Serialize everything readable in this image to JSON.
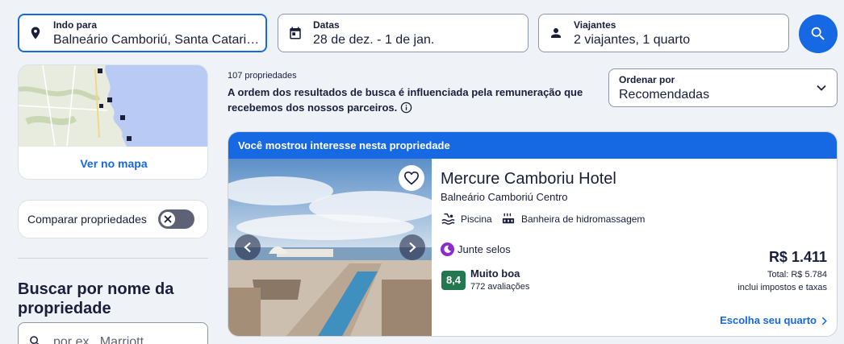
{
  "search": {
    "destination": {
      "label": "Indo para",
      "value": "Balneário Camboriú, Santa Catarina, Brasil",
      "icon": "location-pin-icon"
    },
    "dates": {
      "label": "Datas",
      "value": "28 de dez. - 1 de jan.",
      "icon": "calendar-icon"
    },
    "travelers": {
      "label": "Viajantes",
      "value": "2 viajantes, 1 quarto",
      "icon": "person-icon"
    },
    "search_icon": "magnifier-icon"
  },
  "sidebar": {
    "map_link": "Ver no mapa",
    "compare_label": "Comparar propriedades",
    "compare_enabled": false,
    "name_search_title": "Buscar por nome da propriedade",
    "name_search_placeholder": "por ex., Marriott"
  },
  "results": {
    "count": "107 propriedades",
    "notice": "A ordem dos resultados de busca é influenciada pela remuneração que recebemos dos nossos parceiros.",
    "sort_label": "Ordenar por",
    "sort_value": "Recomendadas"
  },
  "listing": {
    "banner": "Você mostrou interesse nesta propriedade",
    "name": "Mercure Camboriu Hotel",
    "area": "Balneário Camboriú Centro",
    "amenities": [
      {
        "label": "Piscina",
        "icon": "pool-icon"
      },
      {
        "label": "Banheira de hidromassagem",
        "icon": "hot-tub-icon"
      }
    ],
    "stamps": "Junte selos",
    "rating": "8,4",
    "rating_word": "Muito boa",
    "reviews": "772 avaliações",
    "price": "R$ 1.411",
    "total": "Total: R$ 5.784",
    "taxes": "inclui impostos e taxas",
    "cta": "Escolha seu quarto"
  },
  "colors": {
    "accent": "#1668e3",
    "rating_green": "#227950",
    "stamps_purple": "#8c2bc9",
    "text": "#191e3b",
    "background": "#eff3f8"
  }
}
